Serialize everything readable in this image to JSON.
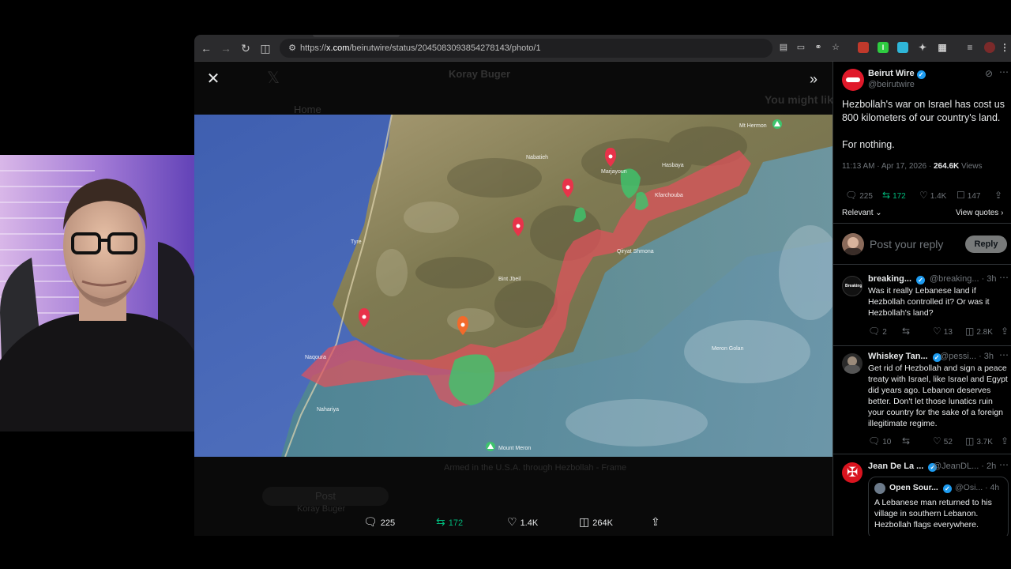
{
  "browser": {
    "url_prefix": "https://",
    "url_domain": "x.com",
    "url_path": "/beirutwire/status/2045083093854278143/photo/1"
  },
  "background": {
    "ghost_author": "Koray Buger",
    "ghost_home": "Home",
    "ghost_might_like": "You might lik",
    "ghost_post_button": "Post",
    "ghost_context": "Armed in the U.S.A. through Hezbollah - Frame",
    "ghost_reply_author": "Koray Buger"
  },
  "map": {
    "labels": {
      "mt_hermon": "Mt Hermon",
      "tyre": "Tyre",
      "naqoura": "Naqoura",
      "qiryat_shmona": "Qiryat Shmona",
      "nahariya": "Nahariya",
      "meron": "Meron Golan",
      "mount_meron": "Mount Meron",
      "nabatieh": "Nabatieh",
      "bint_jbeil": "Bint Jbeil",
      "marjayoun": "Marjayoun",
      "kfarchouba": "Kfarchouba",
      "hasbaya": "Hasbaya"
    }
  },
  "viewer_actions": {
    "replies": "225",
    "reposts": "172",
    "likes": "1.4K",
    "views": "264K"
  },
  "post": {
    "author": "Beirut Wire",
    "handle": "@beirutwire",
    "text1": "Hezbollah's war on Israel has cost us 800 kilometers of our country's land.",
    "text2": "For nothing.",
    "time": "11:13 AM · Apr 17, 2026 · ",
    "views_count": "264.6K",
    "views_label": " Views",
    "replies": "225",
    "reposts": "172",
    "likes": "1.4K",
    "bookmarks": "147",
    "relevant": "Relevant",
    "view_quotes": "View quotes",
    "reply_placeholder": "Post your reply",
    "reply_button": "Reply"
  },
  "replies": [
    {
      "name": "breaking...",
      "handle": "@breaking... · 3h",
      "text": "Was it really Lebanese land if Hezbollah controlled it? Or was it Hezbollah's land?",
      "replies": "2",
      "likes": "13",
      "views": "2.8K"
    },
    {
      "name": "Whiskey Tan...",
      "handle": "@pessi... · 3h",
      "text": "Get rid of Hezbollah and sign a peace treaty with Israel, like Israel and Egypt did years ago. Lebanon deserves better. Don't let those lunatics ruin your country for the sake of a foreign illegitimate regime.",
      "replies": "10",
      "likes": "52",
      "views": "3.7K"
    },
    {
      "name": "Jean De La ...",
      "handle": "@JeanDL... · 2h",
      "quote_name": "Open Sour...",
      "quote_handle": "@Osi... · 4h",
      "quote_text": "A Lebanese man returned to his village in southern Lebanon. Hezbollah flags everywhere."
    }
  ],
  "icons": {
    "back": "back-arrow-icon",
    "forward": "forward-arrow-icon",
    "reload": "reload-icon",
    "close": "close-icon",
    "expand": "chevron-double-right-icon",
    "verified": "verified-badge-icon"
  },
  "colors": {
    "accent": "#1d9bf0",
    "repost_green": "#00ba7c",
    "occupied_zone": "#e0525b",
    "reserve_zone": "#3ec46d"
  }
}
